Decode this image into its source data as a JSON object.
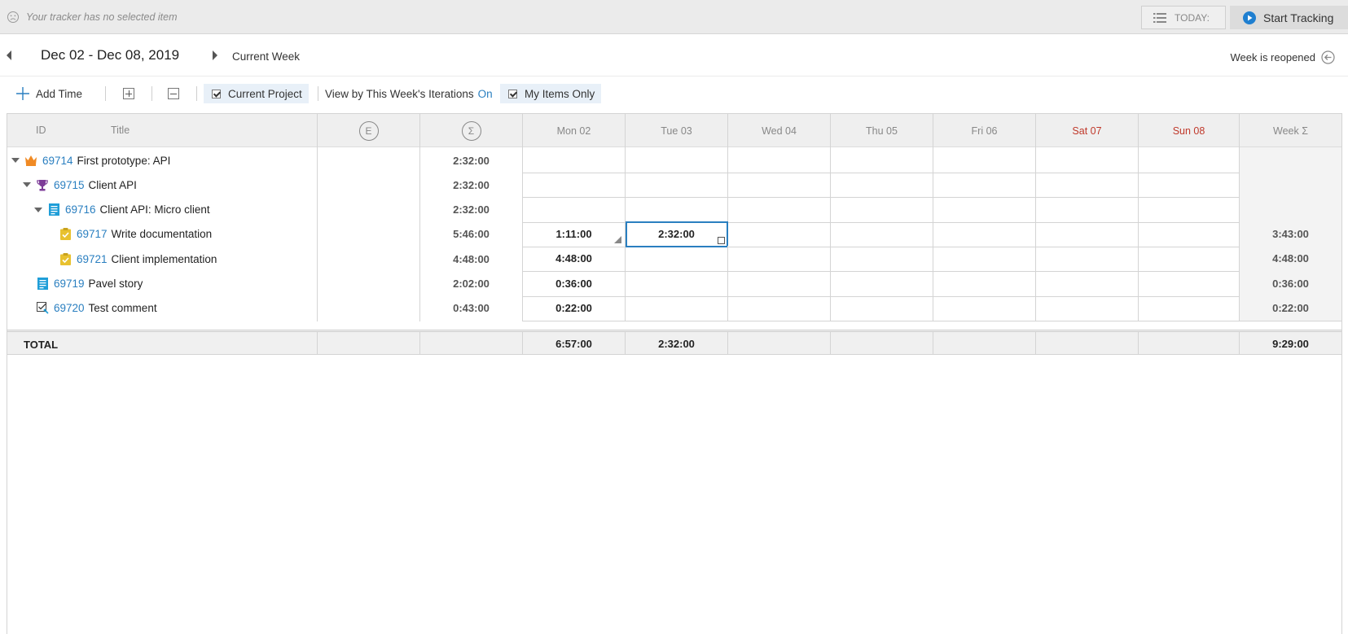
{
  "tracker": {
    "message": "Your tracker has no selected item",
    "today_label": "TODAY:",
    "start_label": "Start Tracking"
  },
  "week": {
    "range": "Dec 02 - Dec 08, 2019",
    "current_label": "Current Week",
    "status": "Week is reopened"
  },
  "toolbar": {
    "add_time": "Add Time",
    "current_project": "Current Project",
    "iterations_label": "View by This Week's Iterations",
    "iterations_state": "On",
    "my_items": "My Items Only"
  },
  "columns": {
    "id": "ID",
    "title": "Title",
    "estimate_symbol": "E",
    "sum_symbol": "Σ",
    "days": [
      "Mon 02",
      "Tue 03",
      "Wed 04",
      "Thu 05",
      "Fri 06",
      "Sat 07",
      "Sun 08"
    ],
    "week": "Week Σ"
  },
  "colors": {
    "link": "#2a7fc0",
    "weekend": "#c0392b",
    "feature": "#f08a24",
    "epic": "#7d3c98",
    "story": "#1f9ed8",
    "task": "#e8c12f"
  },
  "rows": [
    {
      "id": "69714",
      "title": "First prototype: API",
      "icon": "crown-icon",
      "sum": "2:32:00",
      "days": [
        "",
        "",
        "",
        "",
        "",
        "",
        ""
      ],
      "week": ""
    },
    {
      "id": "69715",
      "title": "Client API",
      "icon": "trophy-icon",
      "sum": "2:32:00",
      "days": [
        "",
        "",
        "",
        "",
        "",
        "",
        ""
      ],
      "week": ""
    },
    {
      "id": "69716",
      "title": "Client API: Micro client",
      "icon": "story-icon",
      "sum": "2:32:00",
      "days": [
        "",
        "",
        "",
        "",
        "",
        "",
        ""
      ],
      "week": ""
    },
    {
      "id": "69717",
      "title": "Write documentation",
      "icon": "task-icon",
      "sum": "5:46:00",
      "days": [
        "1:11:00",
        "2:32:00",
        "",
        "",
        "",
        "",
        ""
      ],
      "week": "3:43:00"
    },
    {
      "id": "69721",
      "title": "Client implementation",
      "icon": "task-icon",
      "sum": "4:48:00",
      "days": [
        "4:48:00",
        "",
        "",
        "",
        "",
        "",
        ""
      ],
      "week": "4:48:00"
    },
    {
      "id": "69719",
      "title": "Pavel story",
      "icon": "story-icon",
      "sum": "2:02:00",
      "days": [
        "0:36:00",
        "",
        "",
        "",
        "",
        "",
        ""
      ],
      "week": "0:36:00"
    },
    {
      "id": "69720",
      "title": "Test comment",
      "icon": "test-case-icon",
      "sum": "0:43:00",
      "days": [
        "0:22:00",
        "",
        "",
        "",
        "",
        "",
        ""
      ],
      "week": "0:22:00"
    }
  ],
  "total": {
    "label": "TOTAL",
    "days": [
      "6:57:00",
      "2:32:00",
      "",
      "",
      "",
      "",
      ""
    ],
    "week": "9:29:00"
  }
}
